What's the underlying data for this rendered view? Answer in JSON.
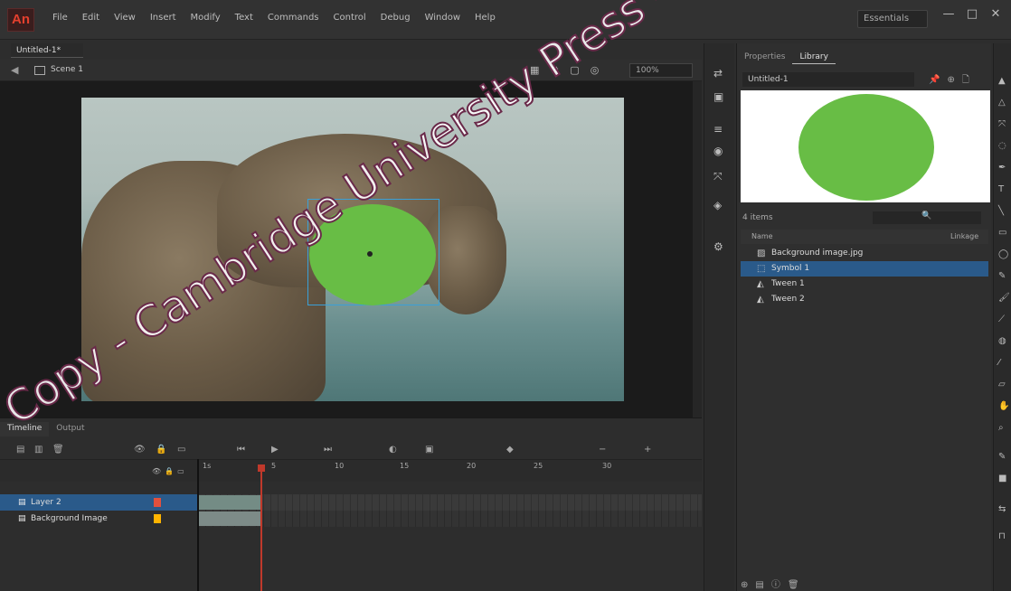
{
  "app": {
    "logo": "An"
  },
  "menu": [
    "File",
    "Edit",
    "View",
    "Insert",
    "Modify",
    "Text",
    "Commands",
    "Control",
    "Debug",
    "Window",
    "Help"
  ],
  "workspace": "Essentials",
  "window_controls": {
    "minimize": "—",
    "maximize": "□",
    "close": "✕"
  },
  "document": {
    "tab": "Untitled-1*",
    "scene": "Scene 1",
    "zoom": "100%"
  },
  "timeline": {
    "tabs": [
      "Timeline",
      "Output"
    ],
    "tick_labels": [
      "1s",
      "5",
      "10",
      "15",
      "20",
      "25",
      "30"
    ],
    "layers": [
      {
        "name": "Layer 2",
        "selected": true,
        "color": "#e2503d"
      },
      {
        "name": "Background Image",
        "selected": false,
        "color": "#ffb400"
      }
    ]
  },
  "library": {
    "tabs": [
      "Properties",
      "Library"
    ],
    "document": "Untitled-1",
    "count": "4 items",
    "search_placeholder": "🔍",
    "columns": {
      "name": "Name",
      "linkage": "Linkage"
    },
    "items": [
      {
        "name": "Background image.jpg",
        "icon": "bitmap-icon",
        "selected": false
      },
      {
        "name": "Symbol 1",
        "icon": "movie-clip-icon",
        "selected": true
      },
      {
        "name": "Tween 1",
        "icon": "graphic-icon",
        "selected": false
      },
      {
        "name": "Tween 2",
        "icon": "graphic-icon",
        "selected": false
      }
    ]
  },
  "watermark": "Copy - Cambridge University Press - Review Copy",
  "colors": {
    "accent_selection": "#2a5a8a",
    "shape_fill": "#68bd45",
    "playhead": "#c0392b"
  }
}
